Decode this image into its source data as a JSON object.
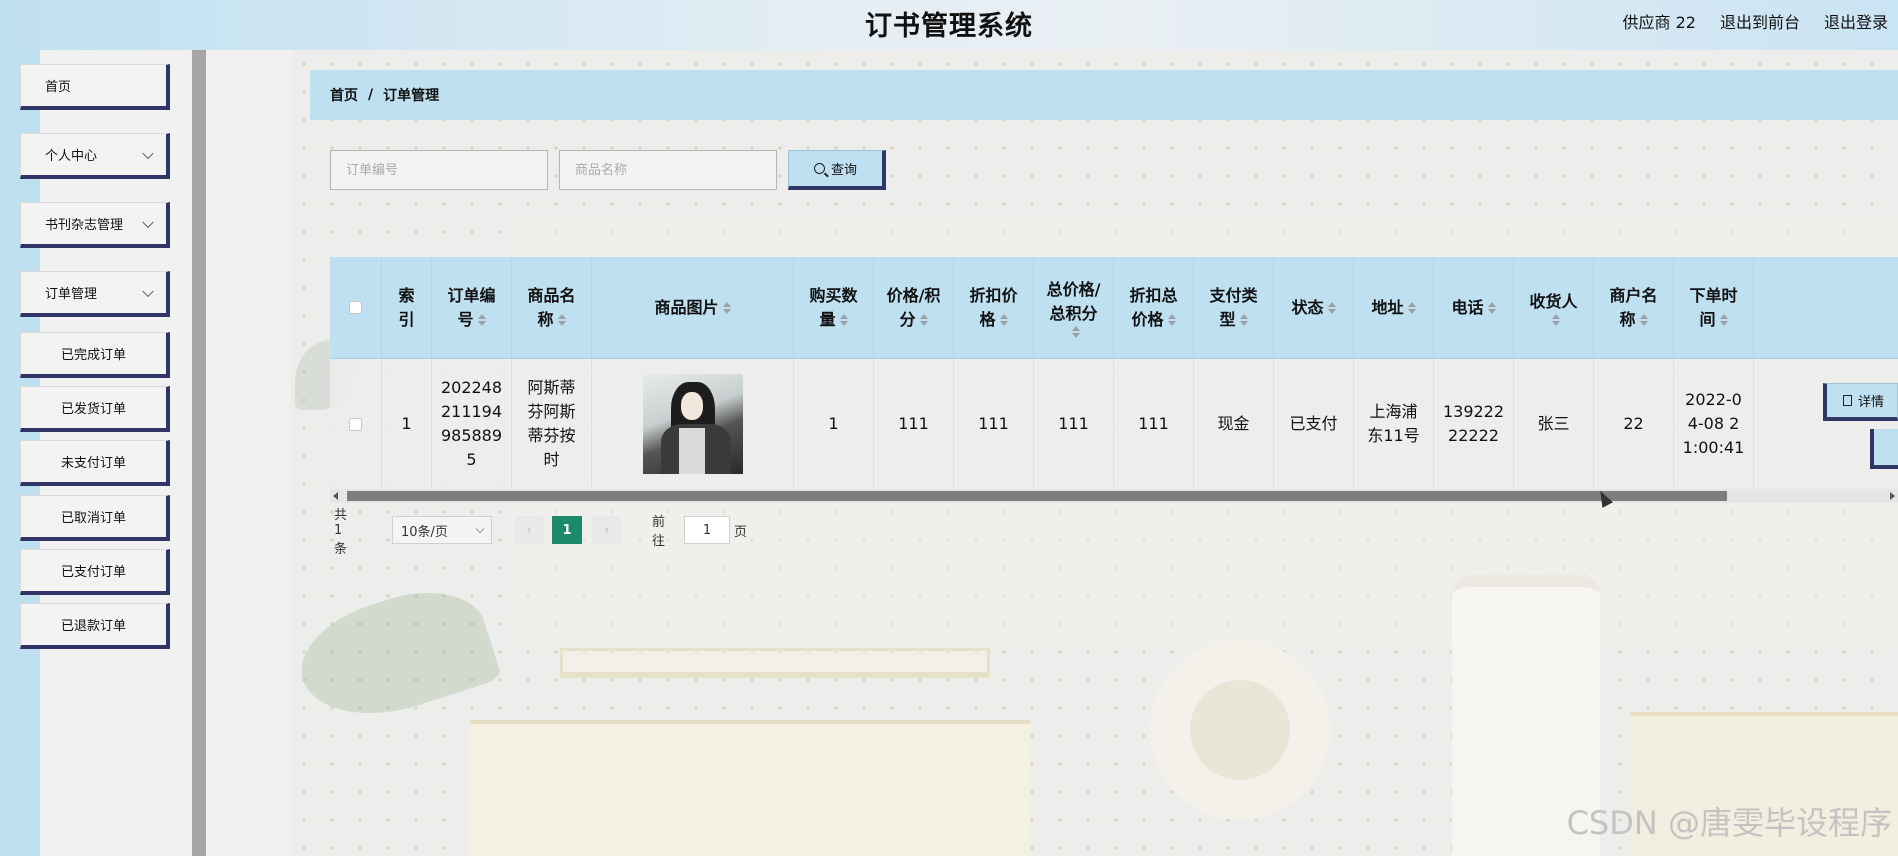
{
  "header": {
    "title": "订书管理系统",
    "user": "供应商 22",
    "exit_front": "退出到前台",
    "logout": "退出登录"
  },
  "sidebar": {
    "items": [
      {
        "label": "首页",
        "expandable": false
      },
      {
        "label": "个人中心",
        "expandable": true
      },
      {
        "label": "书刊杂志管理",
        "expandable": true
      },
      {
        "label": "订单管理",
        "expandable": true
      }
    ],
    "submenu": [
      {
        "label": "已完成订单"
      },
      {
        "label": "已发货订单"
      },
      {
        "label": "未支付订单"
      },
      {
        "label": "已取消订单"
      },
      {
        "label": "已支付订单"
      },
      {
        "label": "已退款订单"
      }
    ]
  },
  "breadcrumb": {
    "home": "首页",
    "separator": "/",
    "current": "订单管理"
  },
  "search": {
    "order_no_placeholder": "订单编号",
    "product_name_placeholder": "商品名称",
    "button_label": "查询"
  },
  "table": {
    "headers": {
      "index": [
        "索",
        "引"
      ],
      "order_no": [
        "订单编",
        "号"
      ],
      "product_name": [
        "商品名",
        "称"
      ],
      "product_image": "商品图片",
      "quantity": [
        "购买数",
        "量"
      ],
      "price": [
        "价格/积",
        "分"
      ],
      "discount_price": [
        "折扣价",
        "格"
      ],
      "total_price": [
        "总价格/",
        "总积分"
      ],
      "discount_total": [
        "折扣总",
        "价格"
      ],
      "payment_type": [
        "支付类",
        "型"
      ],
      "status": "状态",
      "address": "地址",
      "phone": "电话",
      "receiver": "收货人",
      "merchant": [
        "商户名",
        "称"
      ],
      "order_time": [
        "下单时",
        "间"
      ]
    },
    "rows": [
      {
        "index": "1",
        "order_no": [
          "202248",
          "211194",
          "985889",
          "5"
        ],
        "product_name": [
          "阿斯蒂",
          "芬阿斯",
          "蒂芬按",
          "时"
        ],
        "quantity": "1",
        "price": "111",
        "discount_price": "111",
        "total_price": "111",
        "discount_total": "111",
        "payment_type": "现金",
        "status": "已支付",
        "address": [
          "上海浦",
          "东11号"
        ],
        "phone": [
          "139222",
          "22222"
        ],
        "receiver": "张三",
        "merchant": "22",
        "order_time": [
          "2022-0",
          "4-08 2",
          "1:00:41"
        ],
        "action_label": "详情"
      }
    ]
  },
  "pagination": {
    "total": "共 1 条",
    "page_size": "10条/页",
    "current_page": "1",
    "goto_prefix": "前往",
    "goto_value": "1",
    "goto_suffix": "页"
  },
  "watermark": "CSDN @唐雯毕设程序",
  "colors": {
    "accent_blue": "#bfe0f1",
    "border_navy": "#303566",
    "page_active": "#1a8a6b"
  },
  "icons": [
    "chevron-down-icon",
    "search-icon",
    "sort-icon",
    "document-icon",
    "arrow-left-icon",
    "arrow-right-icon"
  ]
}
